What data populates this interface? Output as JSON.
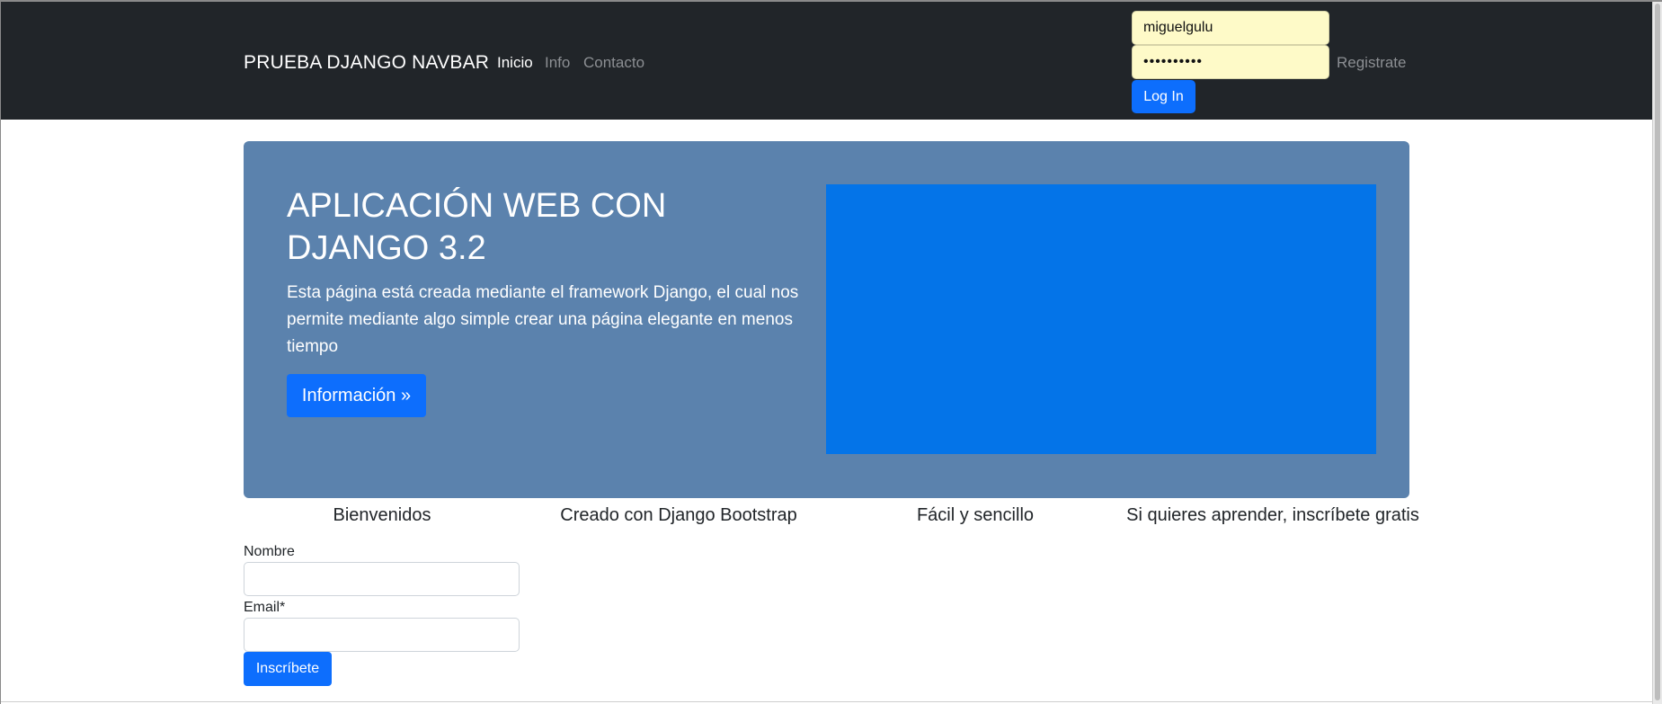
{
  "navbar": {
    "brand": "PRUEBA DJANGO NAVBAR",
    "links": [
      {
        "label": "Inicio",
        "active": true
      },
      {
        "label": "Info",
        "active": false
      },
      {
        "label": "Contacto",
        "active": false
      }
    ],
    "login": {
      "username_value": "miguelgulu",
      "password_value": "••••••••••",
      "button_label": "Log In"
    },
    "register_label": "Registrate"
  },
  "hero": {
    "title": "APLICACIÓN WEB CON DJANGO 3.2",
    "text": "Esta página está creada mediante el framework Django, el cual nos permite mediante algo simple crear una página elegante en menos tiempo",
    "button_label": "Información »"
  },
  "features": [
    "Bienvenidos",
    "Creado con Django Bootstrap",
    "Fácil y sencillo",
    "Si quieres aprender, inscríbete gratis"
  ],
  "signup_form": {
    "name_label": "Nombre",
    "email_label": "Email*",
    "submit_label": "Inscríbete"
  },
  "colors": {
    "navbar_bg": "#212529",
    "hero_bg": "#5b82ad",
    "media_box": "#0474e8",
    "primary": "#0d6efd"
  }
}
